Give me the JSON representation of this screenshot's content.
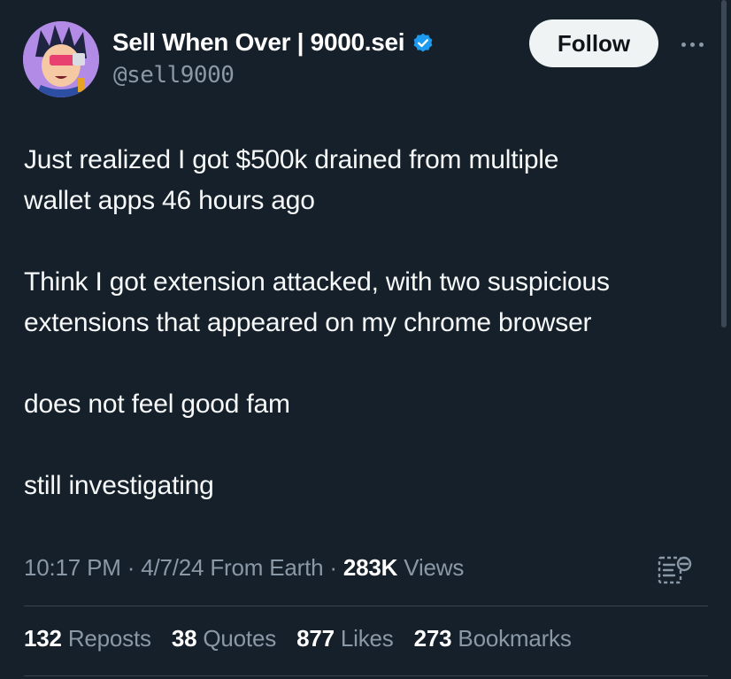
{
  "author": {
    "display_name": "Sell When Over | 9000.sei",
    "handle": "@sell9000",
    "verified": true,
    "verified_color": "#1d9bf0"
  },
  "actions": {
    "follow_label": "Follow",
    "more_icon": "more-horizontal-icon"
  },
  "tweet": {
    "paragraphs": [
      [
        "Just realized I got $500k drained from multiple",
        "wallet apps 46 hours ago"
      ],
      [
        "Think I got extension attacked, with two suspicious",
        "extensions that appeared on my chrome browser"
      ],
      [
        "does not feel good fam"
      ],
      [
        "still investigating"
      ]
    ]
  },
  "meta": {
    "time": "10:17 PM",
    "separator": "·",
    "date": "4/7/24",
    "location": "From Earth",
    "views_count": "283K",
    "views_label": "Views",
    "analytics_icon": "analytics-icon"
  },
  "stats": {
    "reposts": {
      "count": "132",
      "label": "Reposts"
    },
    "quotes": {
      "count": "38",
      "label": "Quotes"
    },
    "likes": {
      "count": "877",
      "label": "Likes"
    },
    "bookmarks": {
      "count": "273",
      "label": "Bookmarks"
    }
  },
  "colors": {
    "background": "#15202b",
    "text": "#f7f9f9",
    "muted": "#8b98a5",
    "divider": "#38444d",
    "follow_bg": "#eff3f4"
  }
}
